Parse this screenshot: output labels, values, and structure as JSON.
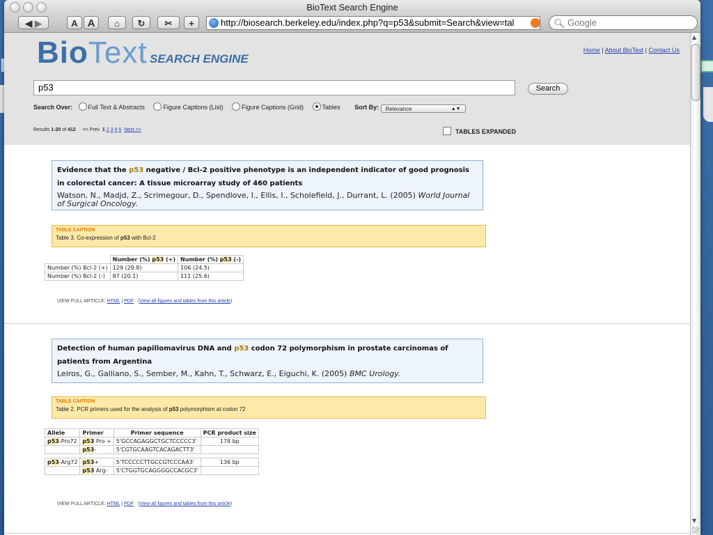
{
  "window": {
    "title": "BioText Search Engine"
  },
  "toolbar": {
    "text_smaller": "A",
    "text_larger": "A",
    "home_icon": "⌂",
    "reload_icon": "↻",
    "snap_icon": "✂",
    "add_icon": "+",
    "url": "http://biosearch.berkeley.edu/index.php?q=p53&submit=Search&view=tal",
    "search_placeholder": "Google"
  },
  "header": {
    "logo_bold": "Bio",
    "logo_light": "Text",
    "logo_sub": "SEARCH ENGINE",
    "links": [
      "Home",
      "About BioText",
      "Contact Us"
    ],
    "query": "p53",
    "search_button": "Search",
    "search_over_label": "Search Over:",
    "search_options": [
      {
        "label": "Full Text & Abstracts",
        "selected": false
      },
      {
        "label": "Figure Captions (List)",
        "selected": false
      },
      {
        "label": "Figure Captions (Grid)",
        "selected": false
      },
      {
        "label": "Tables",
        "selected": true
      }
    ],
    "sort_label": "Sort By:",
    "sort_value": "Relevance",
    "results_prefix": "Results",
    "results_range": "1-20",
    "results_of": "of",
    "results_total": "412",
    "prev_label": "<< Prev",
    "current_page": "1",
    "pages": [
      "2",
      "3",
      "4",
      "5"
    ],
    "next_label": "Next >>",
    "tables_expanded": "TABLES EXPANDED"
  },
  "results": [
    {
      "title_parts": [
        "Evidence that the ",
        "p53",
        " negative / Bcl-2 positive phenotype is an independent indicator of good prognosis in colorectal cancer: A tissue microarray study of 460 patients"
      ],
      "authors": "Watson, N., Madjd, Z., Scrimegour, D., Spendlove, I., Ellis, I., Scholefield, J., Durrant, L. (2005)",
      "journal": "World Journal of Surgical Oncology.",
      "caption_label": "TABLE CAPTION",
      "caption_parts": [
        "Table 3. Co-expression of ",
        "p53",
        " with Bcl-2"
      ],
      "table": {
        "headers": [
          "",
          "Number (%) p53 (+)",
          "Number (%) p53 (-)"
        ],
        "rows": [
          [
            "Number (%) Bcl-2 (+)",
            "129 (29.8)",
            "106 (24.5)"
          ],
          [
            "Number (%) Bcl-2 (-)",
            "87 (20.1)",
            "111 (25.6)"
          ]
        ]
      },
      "view_full": "VIEW FULL ARTICLE:",
      "html_link": "HTML",
      "sep": "|",
      "pdf_link": "PDF",
      "all_link": "View all figures and tables from this article"
    },
    {
      "title_parts": [
        "Detection of human papillomavirus DNA and ",
        "p53",
        " codon 72 polymorphism in prostate carcinomas of patients from Argentina"
      ],
      "authors": "Leiros, G., Galliano, S., Sember, M., Kahn, T., Schwarz, E., Eiguchi, K. (2005)",
      "journal": "BMC Urology.",
      "caption_label": "TABLE CAPTION",
      "caption_parts": [
        "Table 2. PCR primers used for the analysis of ",
        "p53",
        " polymorphism at codon 72"
      ],
      "table": {
        "headers": [
          "Allele",
          "Primer",
          "Primer sequence",
          "PCR product size"
        ],
        "rows": [
          [
            "p53-Pro72",
            "p53 Pro +",
            "5'GCCAGAGGCTGCTCCCCC3'",
            "178 bp"
          ],
          [
            "",
            "p53-",
            "5'CGTGCAAGTCACAGACTT3'",
            ""
          ],
          [
            "p53-Arg72",
            "p53+",
            "5'TCCCCCTTGCCGTCCCAA3'",
            "136 bp"
          ],
          [
            "",
            "p53 Arg-",
            "5'CTGGTGCAGGGGCCACGC3'",
            ""
          ]
        ]
      },
      "view_full": "VIEW FULL ARTICLE:",
      "html_link": "HTML",
      "sep": "|",
      "pdf_link": "PDF",
      "all_link": "View all figures and tables from this article"
    }
  ],
  "background": {
    "letter": "B"
  }
}
